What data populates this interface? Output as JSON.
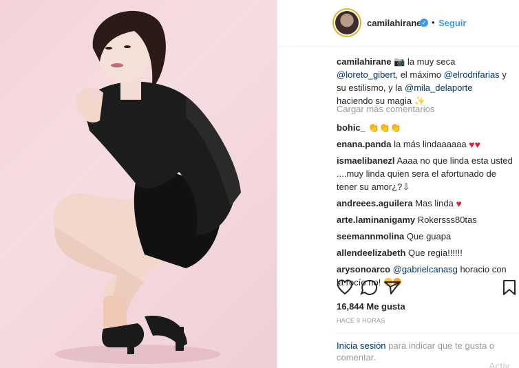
{
  "post": {
    "username": "camilahirane",
    "follow_label": "Seguir",
    "dot": "•",
    "verified_glyph": "✓"
  },
  "caption": {
    "user": "camilahirane",
    "part1": "la muy seca",
    "mention1": "@loreto_gibert",
    "part2": ", el máximo",
    "mention2": "@elrodrifarias",
    "part3": "y su estilismo, y la",
    "mention3": "@mila_delaporte",
    "part4": "haciendo su magia"
  },
  "load_more": "Cargar más comentarios",
  "comments": [
    {
      "user": "bohic_",
      "text": ""
    },
    {
      "user": "enana.panda",
      "text": "la más lindaaaaaa"
    },
    {
      "user": "ismaelibanezl",
      "text": "Aaaa no que linda esta usted ....muy linda quien sera el afortunado de tener su amor¿?⇩"
    },
    {
      "user": "andreees.aguilera",
      "text": "Mas linda"
    },
    {
      "user": "arte.laminanigamy",
      "text": "Rokersss80tas"
    },
    {
      "user": "seemannmolina",
      "text": "Que guapa"
    },
    {
      "user": "allendeelizabeth",
      "text": "Que regia!!!!!!"
    },
    {
      "user": "arysonoarco",
      "mention": "@gabrielcanasg",
      "text": "horacio con la rocío no!"
    }
  ],
  "likes": "16,844 Me gusta",
  "time": "HACE 9 HORAS",
  "login": {
    "link": "Inicia sesión",
    "text": "para indicar que te gusta o comentar."
  },
  "watermark": "Activ",
  "colors": {
    "link": "#3897f0",
    "mention": "#003569",
    "muted": "#999999",
    "photo_bg": "#f4d3da"
  },
  "icons": [
    "heart-icon",
    "comment-icon",
    "share-icon",
    "bookmark-icon",
    "camera-emoji",
    "sparkle-emoji",
    "clap-emoji",
    "heart-emoji",
    "laughing-emoji",
    "smirk-emoji"
  ]
}
